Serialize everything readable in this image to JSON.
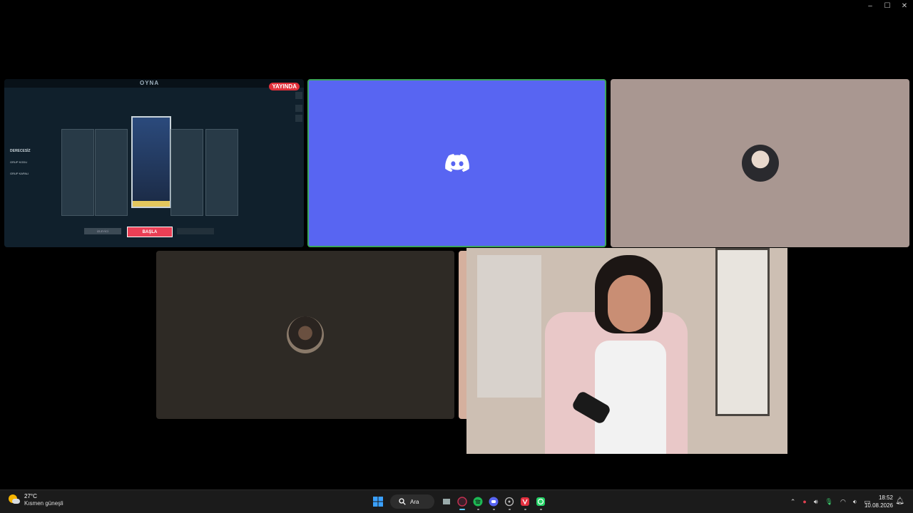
{
  "window": {
    "minimize": "–",
    "maximize": "☐",
    "close": "✕"
  },
  "game_screen": {
    "title": "OYNA",
    "live_badge": "YAYINDA",
    "side_main": "DERECESİZ",
    "side_items": [
      "GRUP KODU",
      "GRUP KAPALI"
    ],
    "start_button": "BAŞLA",
    "left_button": "İZLEYİCİ"
  },
  "tiles": {
    "discord_logo": "discord-icon",
    "colors": {
      "discord": "#5865f2",
      "speaking_border": "#3ba55c",
      "live": "#e0303a"
    }
  },
  "taskbar": {
    "weather_temp": "27°C",
    "weather_desc": "Kısmen güneşli",
    "search_label": "Ara",
    "time": "18:52",
    "date": "10.08.2026"
  }
}
